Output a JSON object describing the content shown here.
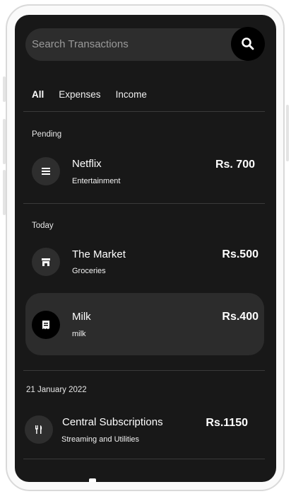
{
  "search": {
    "placeholder": "Search Transactions"
  },
  "tabs": [
    {
      "label": "All",
      "active": true
    },
    {
      "label": "Expenses",
      "active": false
    },
    {
      "label": "Income",
      "active": false
    }
  ],
  "groups": [
    {
      "title": "Pending",
      "items": [
        {
          "name": "Netflix",
          "category": "Entertainment",
          "amount": "Rs. 700",
          "icon": "list-icon"
        }
      ]
    },
    {
      "title": "Today",
      "items": [
        {
          "name": "The Market",
          "category": "Groceries",
          "amount": "Rs.500",
          "icon": "store-icon"
        },
        {
          "name": "Milk",
          "category": "milk",
          "amount": "Rs.400",
          "icon": "receipt-icon",
          "selected": true
        }
      ]
    },
    {
      "title": "21 January 2022",
      "items": [
        {
          "name": "Central Subscriptions",
          "category": "Streaming and Utilities",
          "amount": "Rs.1150",
          "icon": "utensils-icon"
        }
      ]
    }
  ],
  "colors": {
    "background": "#181818",
    "selected_row": "#2c2c2c",
    "icon_bg": "#2e2e2e"
  }
}
